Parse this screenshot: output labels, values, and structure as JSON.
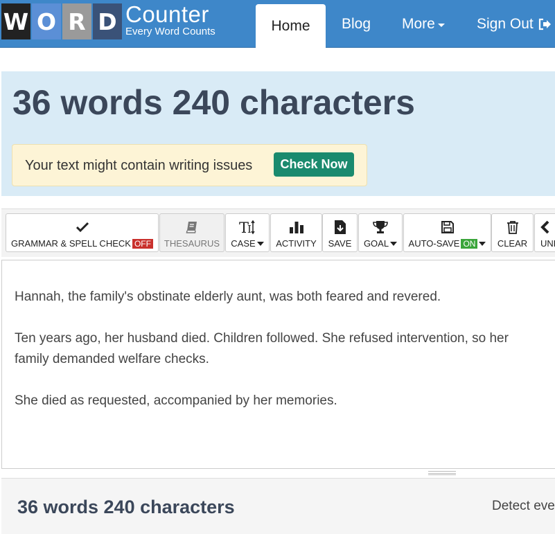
{
  "logo": {
    "letters": [
      "W",
      "O",
      "R",
      "D"
    ],
    "title": "Counter",
    "subtitle": "Every Word Counts"
  },
  "nav": {
    "home": "Home",
    "blog": "Blog",
    "more": "More",
    "sign_out": "Sign Out"
  },
  "stats": {
    "title": "36 words 240 characters",
    "issues_text": "Your text might contain writing issues",
    "check_button": "Check Now"
  },
  "toolbar": {
    "grammar": "GRAMMAR & SPELL CHECK",
    "grammar_state": "OFF",
    "thesaurus": "THESAURUS",
    "case": "CASE",
    "activity": "ACTIVITY",
    "save": "SAVE",
    "goal": "GOAL",
    "autosave": "AUTO-SAVE",
    "autosave_state": "ON",
    "clear": "CLEAR",
    "undo": "UNDO"
  },
  "editor": {
    "paragraphs": [
      "Hannah, the family's obstinate elderly aunt, was both feared and revered.",
      "Ten years ago, her husband died. Children followed. She refused intervention, so her family demanded welfare checks.",
      "She died as requested, accompanied by her memories."
    ]
  },
  "bottom": {
    "title": "36 words 240 characters",
    "detect_text": "Detect every"
  },
  "colors": {
    "navbar": "#3e87c9",
    "stats_bg": "#d9ebf6",
    "check_button": "#1a8a6e",
    "badge_off": "#c9302c",
    "badge_on": "#3aa53a"
  }
}
